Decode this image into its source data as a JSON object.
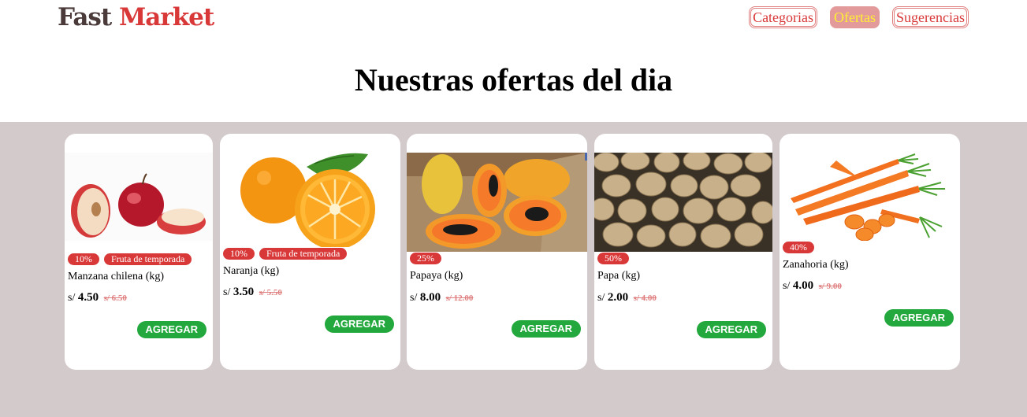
{
  "brand": {
    "part1": "Fast",
    "part2": "Market"
  },
  "nav": [
    {
      "label": "Categorias",
      "active": false
    },
    {
      "label": "Ofertas",
      "active": true
    },
    {
      "label": "Sugerencias",
      "active": false
    }
  ],
  "page_title": "Nuestras ofertas del dia",
  "button_label": "AGREGAR",
  "products": [
    {
      "discount": "10%",
      "tag": "Fruta de temporada",
      "name": "Manzana chilena (kg)",
      "currency": "s/",
      "price": "4.50",
      "old_price": "s/ 6.50",
      "image": "apple"
    },
    {
      "discount": "10%",
      "tag": "Fruta de temporada",
      "name": "Naranja (kg)",
      "currency": "s/",
      "price": "3.50",
      "old_price": "s/ 5.50",
      "image": "orange"
    },
    {
      "discount": "25%",
      "name": "Papaya (kg)",
      "currency": "s/",
      "price": "8.00",
      "old_price": "s/ 12.00",
      "image": "papaya"
    },
    {
      "discount": "50%",
      "name": "Papa (kg)",
      "currency": "s/",
      "price": "2.00",
      "old_price": "s/ 4.00",
      "image": "potato"
    },
    {
      "discount": "40%",
      "name": "Zanahoria (kg)",
      "currency": "s/",
      "price": "4.00",
      "old_price": "s/ 9.00",
      "image": "carrot"
    }
  ]
}
